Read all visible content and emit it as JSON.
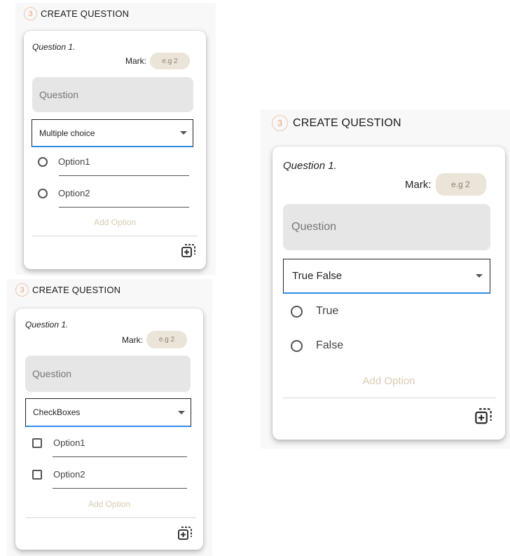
{
  "panels": [
    {
      "step_number": "3",
      "section_title": "CREATE QUESTION",
      "question_label": "Question 1.",
      "mark_label": "Mark:",
      "mark_placeholder": "e.g 2",
      "question_placeholder": "Question",
      "question_type": "Multiple choice",
      "option_control": "radio",
      "options": [
        "Option1",
        "Option2"
      ],
      "add_option_label": "Add Option",
      "add_question_icon": "add-question-icon"
    },
    {
      "step_number": "3",
      "section_title": "CREATE QUESTION",
      "question_label": "Question 1.",
      "mark_label": "Mark:",
      "mark_placeholder": "e.g 2",
      "question_placeholder": "Question",
      "question_type": "CheckBoxes",
      "option_control": "checkbox",
      "options": [
        "Option1",
        "Option2"
      ],
      "add_option_label": "Add Option",
      "add_question_icon": "add-question-icon"
    },
    {
      "step_number": "3",
      "section_title": "CREATE QUESTION",
      "question_label": "Question 1.",
      "mark_label": "Mark:",
      "mark_placeholder": "e.g 2",
      "question_placeholder": "Question",
      "question_type": "True False",
      "option_control": "radio",
      "options": [
        "True",
        "False"
      ],
      "add_option_label": "Add Option",
      "add_question_icon": "add-question-icon"
    }
  ],
  "colors": {
    "step_circle": "#e8c9b4",
    "mark_input_bg": "#ebe4d8",
    "question_box_bg": "#e6e6e6",
    "select_underline": "#2f8ce6",
    "add_option_text": "#d9cbb2"
  }
}
